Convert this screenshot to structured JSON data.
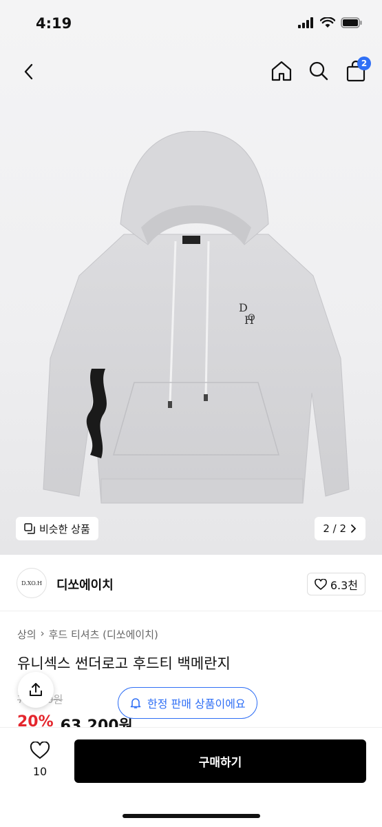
{
  "status": {
    "time": "4:19"
  },
  "nav": {
    "cart_count": "2"
  },
  "hero": {
    "similar_label": "비슷한 상품",
    "page_indicator": "2 / 2",
    "chest_logo": "D.O.H",
    "hood_tag": "D.XO.H"
  },
  "brand": {
    "logo_text": "D.XO.H",
    "name": "디쏘에이치",
    "likes": "6.3천"
  },
  "breadcrumb": {
    "level1": "상의",
    "level2": "후드 티셔츠 (디쏘에이치)"
  },
  "product": {
    "title": "유니섹스 썬더로고 후드티 백메란지",
    "old_price": "79,000원",
    "discount": "20%",
    "price": "63,200원"
  },
  "limited_notice": "한정 판매 상품이에요",
  "bottom": {
    "like_count": "10",
    "buy_label": "구매하기"
  },
  "colors": {
    "accent": "#2f6ff5",
    "discount": "#e4262d"
  }
}
